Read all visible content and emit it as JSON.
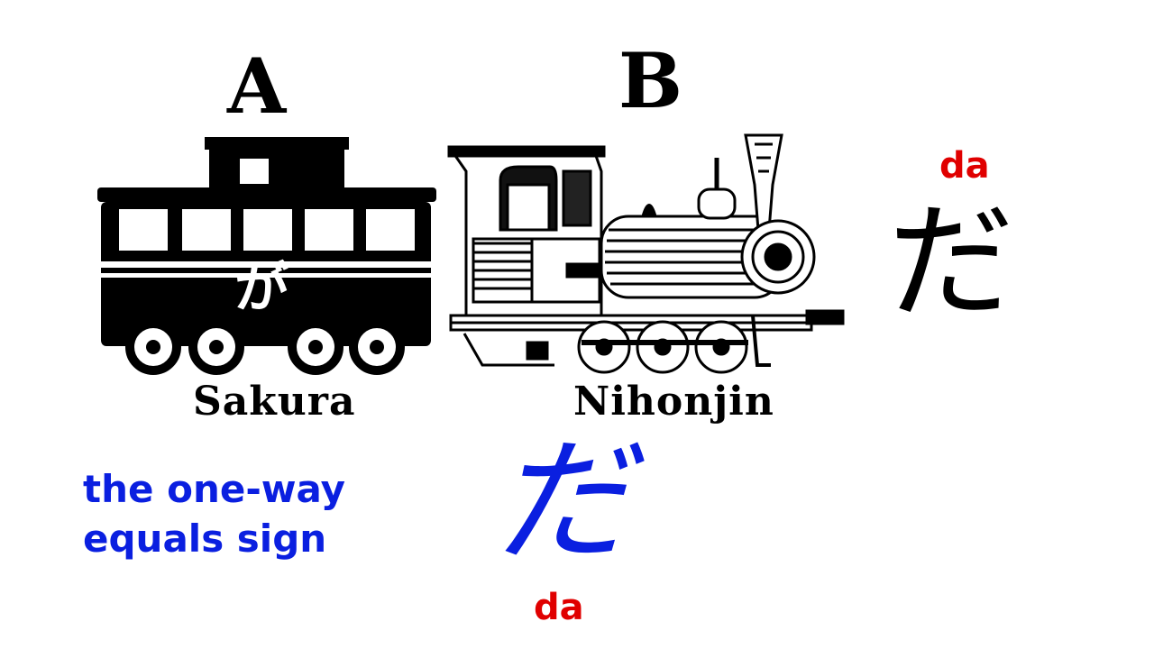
{
  "labels": {
    "a": "A",
    "b": "B",
    "sakura": "Sakura",
    "nihonjin": "Nihonjin"
  },
  "car_kana": "が",
  "particle": {
    "kana_top": "だ",
    "romaji_top": "da",
    "kana_bottom": "だ",
    "romaji_bottom": "da"
  },
  "caption": {
    "line1": "the one-way",
    "line2": "equals sign"
  },
  "colors": {
    "caption": "#0a1fe0",
    "romaji": "#e00000",
    "ink": "#000000"
  },
  "icons": [
    "train-car-icon",
    "steam-locomotive-icon"
  ]
}
